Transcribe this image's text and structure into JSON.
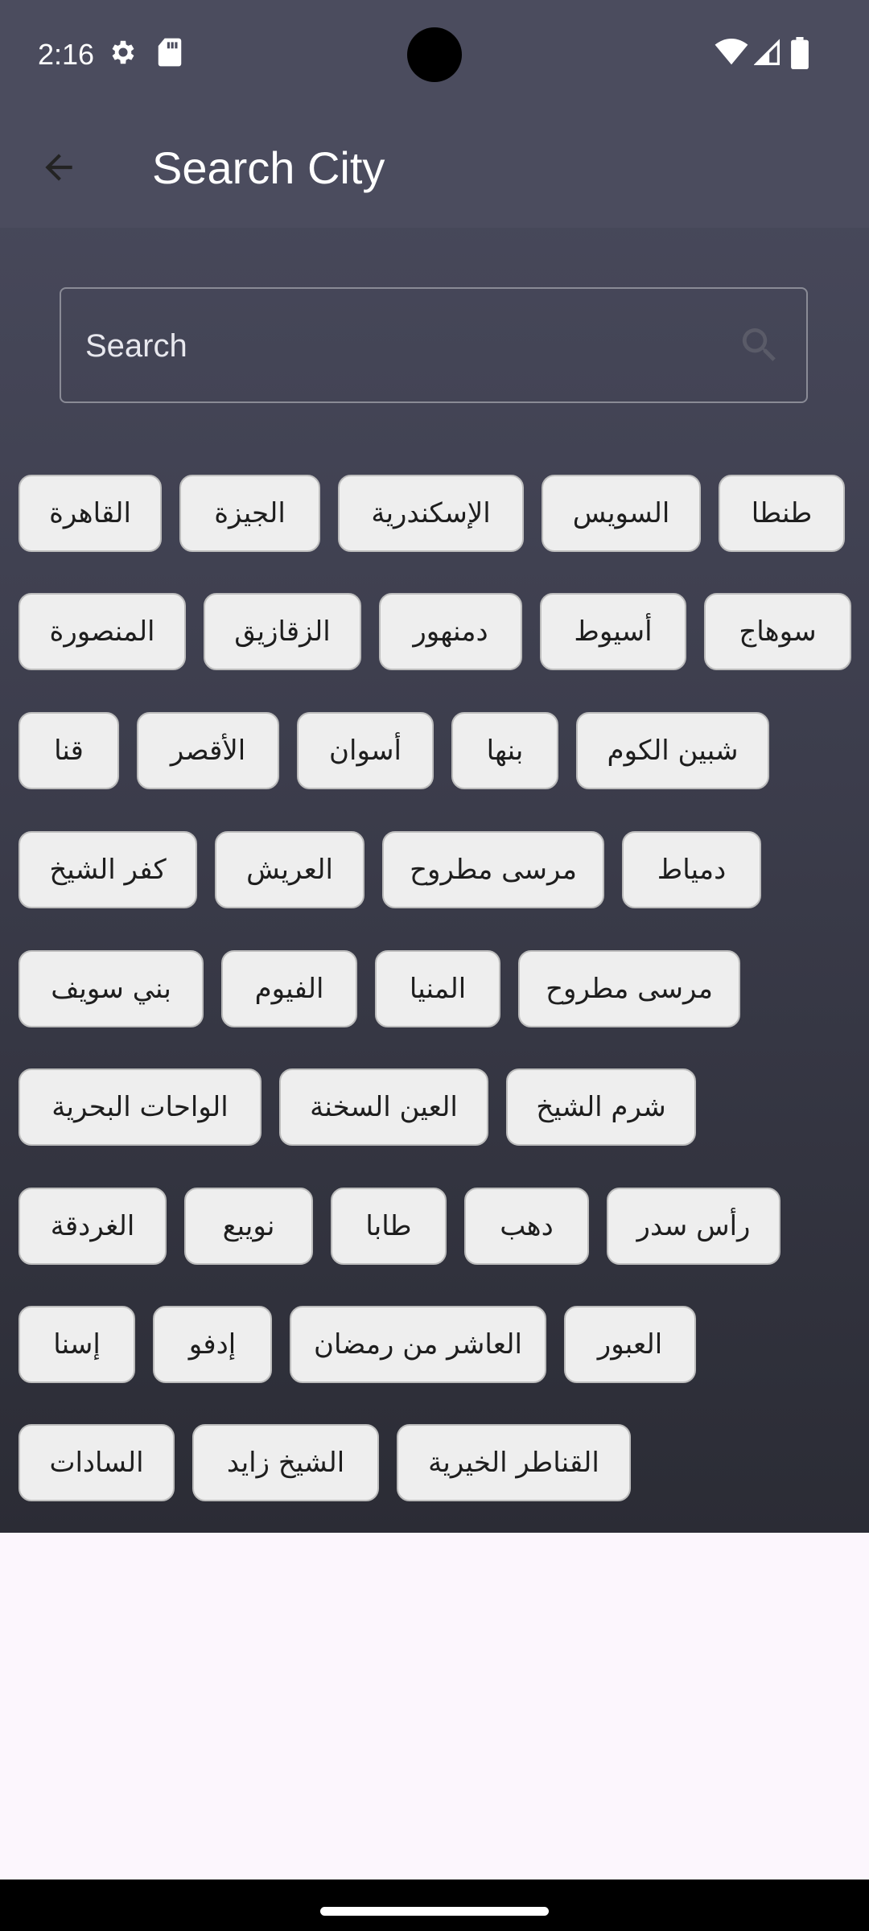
{
  "status_bar": {
    "time": "2:16",
    "icons": [
      "settings-icon",
      "sd-card-icon",
      "wifi-icon",
      "signal-icon",
      "battery-icon"
    ]
  },
  "app_bar": {
    "title": "Search City",
    "back_icon": "arrow-left-icon"
  },
  "search": {
    "placeholder": "Search",
    "value": ""
  },
  "colors": {
    "background_top": "#4b4c5f",
    "background_bottom": "#2b2c35",
    "chip_bg": "#eeeeee",
    "chip_border": "#bdbdbd",
    "page_bg": "#fcf6fd"
  },
  "cities": [
    [
      "القاهرة",
      "الجيزة",
      "الإسكندرية",
      "السويس",
      "طنطا"
    ],
    [
      "المنصورة",
      "الزقازيق",
      "دمنهور",
      "أسيوط",
      "سوهاج"
    ],
    [
      "قنا",
      "الأقصر",
      "أسوان",
      "بنها",
      "شبين الكوم"
    ],
    [
      "كفر الشيخ",
      "العريش",
      "مرسى مطروح",
      "دمياط"
    ],
    [
      "بني سويف",
      "الفيوم",
      "المنيا",
      "مرسى مطروح"
    ],
    [
      "الواحات البحرية",
      "العين السخنة",
      "شرم الشيخ"
    ],
    [
      "الغردقة",
      "نويبع",
      "طابا",
      "دهب",
      "رأس سدر"
    ],
    [
      "إسنا",
      "إدفو",
      "العاشر من رمضان",
      "العبور"
    ],
    [
      "السادات",
      "الشيخ زايد",
      "القناطر الخيرية"
    ]
  ]
}
